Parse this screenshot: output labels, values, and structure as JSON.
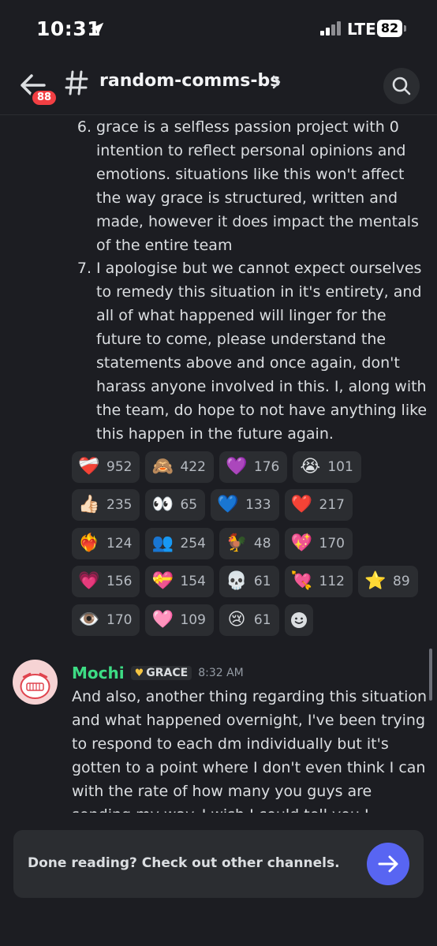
{
  "status_bar": {
    "time": "10:31",
    "network": "LTE",
    "battery": "82"
  },
  "header": {
    "badge_count": "88",
    "channel_name": "random-comms-bs"
  },
  "message1": {
    "items": [
      {
        "num": "6.",
        "text": "grace is a selfless passion project with 0 intention to reflect personal opinions and emotions. situations like this won't affect the way grace is structured, written and made, however it does impact the mentals of the entire team"
      },
      {
        "num": "7.",
        "text": "I apologise but we cannot expect ourselves to remedy this situation in it's entirety, and all of what happened will linger for the future to come, please understand the statements above and once again, don't harass anyone involved in this. I, along with the team, do hope to not have anything like this happen in the future again."
      }
    ],
    "reaction_rows": [
      [
        {
          "emoji": "❤️‍🩹",
          "count": "952"
        },
        {
          "emoji": "🙈",
          "count": "422"
        },
        {
          "emoji": "💜",
          "count": "176"
        },
        {
          "emoji": "😭",
          "count": "101"
        }
      ],
      [
        {
          "emoji": "👍🏻",
          "count": "235"
        },
        {
          "emoji": "👀",
          "count": "65"
        },
        {
          "emoji": "💙",
          "count": "133"
        },
        {
          "emoji": "❤️",
          "count": "217"
        }
      ],
      [
        {
          "emoji": "❤️‍🔥",
          "count": "124"
        },
        {
          "emoji": "👥",
          "count": "254"
        },
        {
          "emoji": "🐓",
          "count": "48"
        },
        {
          "emoji": "💖",
          "count": "170"
        }
      ],
      [
        {
          "emoji": "💗",
          "count": "156"
        },
        {
          "emoji": "💝",
          "count": "154"
        },
        {
          "emoji": "💀",
          "count": "61"
        },
        {
          "emoji": "💘",
          "count": "112"
        },
        {
          "emoji": "⭐",
          "count": "89"
        }
      ],
      [
        {
          "emoji": "👁️",
          "count": "170"
        },
        {
          "emoji": "🩷",
          "count": "109"
        },
        {
          "emoji": "😢",
          "count": "61"
        }
      ]
    ],
    "add_reaction_icon": "smiley-icon"
  },
  "message2": {
    "author": "Mochi",
    "tag": "GRACE",
    "timestamp": "8:32 AM",
    "text": "And also, another thing regarding this situation and what happened overnight, I've been trying to respond to each dm individually but it's gotten to a point where I don't even think I can with the rate of how many you guys are sending my way. I wish I could tell you I"
  },
  "bottom_prompt": {
    "text": "Done reading? Check out other channels."
  },
  "colors": {
    "accent": "#5865f2",
    "author": "#3ddc84",
    "badge": "#f23f43"
  }
}
